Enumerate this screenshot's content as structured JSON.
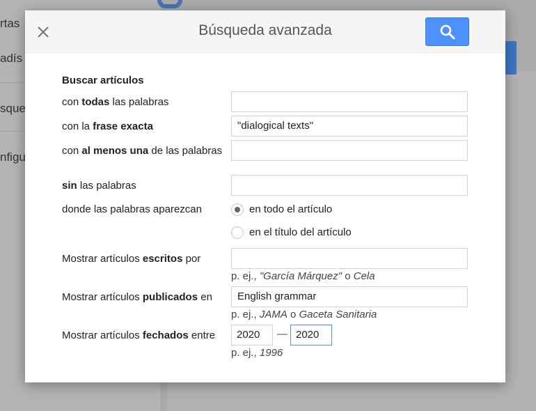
{
  "background": {
    "sidebar_items": [
      "rtas",
      "adís",
      "sque",
      "nfigu"
    ]
  },
  "dialog": {
    "title": "Búsqueda avanzada",
    "section_title": "Buscar artículos",
    "all_words": {
      "pre": "con ",
      "bold": "todas",
      "post": " las palabras",
      "value": ""
    },
    "exact_phrase": {
      "pre": "con la ",
      "bold": "frase exacta",
      "post": "",
      "value": "\"dialogical texts\""
    },
    "at_least_one": {
      "pre": "con ",
      "bold": "al menos una",
      "post": " de las palabras",
      "value": ""
    },
    "without_words": {
      "pre": "",
      "bold": "sin",
      "post": " las palabras",
      "value": ""
    },
    "where": {
      "label": "donde las palabras aparezcan",
      "options": [
        "en todo el artículo",
        "en el título del artículo"
      ],
      "selected": 0
    },
    "author": {
      "pre": "Mostrar artículos ",
      "bold": "escritos",
      "post": " por",
      "value": "",
      "hint_pre": "p. ej., ",
      "hint_i1": "\"García Márquez\"",
      "hint_mid": " o ",
      "hint_i2": "Cela"
    },
    "publication": {
      "pre": "Mostrar artículos ",
      "bold": "publicados",
      "post": " en",
      "value": "English grammar",
      "hint_pre": "p. ej., ",
      "hint_i1": "JAMA",
      "hint_mid": " o ",
      "hint_i2": "Gaceta Sanitaria"
    },
    "dates": {
      "pre": "Mostrar artículos ",
      "bold": "fechados",
      "post": " entre",
      "from": "2020",
      "to": "2020",
      "separator": "—",
      "hint_pre": "p. ej., ",
      "hint_i1": "1996"
    }
  },
  "colors": {
    "accent": "#4d90fe",
    "overlay": "#ababab"
  },
  "icons": {
    "close": "close-icon",
    "search": "search-icon"
  }
}
